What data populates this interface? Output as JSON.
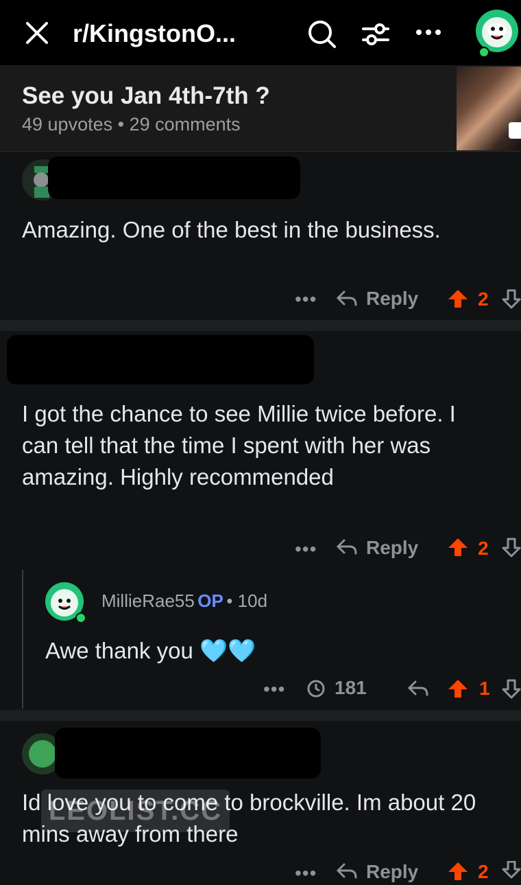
{
  "header": {
    "title": "r/KingstonO...",
    "close_icon": "close-icon",
    "search_icon": "search-icon",
    "filter_icon": "filter-icon",
    "more_icon": "more-icon",
    "avatar_icon": "snoo-avatar-icon"
  },
  "post": {
    "title": "See you Jan 4th-7th ?",
    "upvotes": "49 upvotes",
    "separator": "•",
    "comments": "29 comments"
  },
  "comments": [
    {
      "text": "Amazing. One of the best in the business.",
      "reply_label": "Reply",
      "score": "2"
    },
    {
      "text": "I got the chance to see Millie twice before. I can tell that the time I spent with her was amazing. Highly recommended",
      "reply_label": "Reply",
      "score": "2",
      "reply": {
        "author": "MillieRae55",
        "op_badge": "OP",
        "age": "• 10d",
        "text": "Awe thank you 🩵🩵",
        "views": "181",
        "score": "1"
      }
    },
    {
      "text": "Id love you to come to brockville. Im about 20 mins away from there",
      "reply_label": "Reply",
      "score": "2"
    }
  ],
  "watermark": "LEOLIST.CC",
  "colors": {
    "upvote": "#ff4500",
    "op": "#6b8cff",
    "background": "#111214"
  }
}
